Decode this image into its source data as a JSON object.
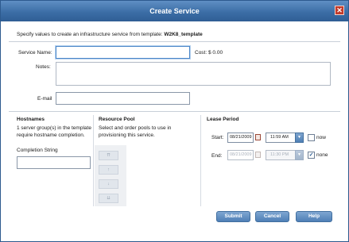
{
  "dialog": {
    "title": "Create Service",
    "close_glyph": "✕"
  },
  "intro": {
    "text": "Specify values to create an infrastructure service from template:",
    "template": "W2K8_template"
  },
  "form": {
    "service_name_label": "Service Name:",
    "service_name_value": "",
    "cost_label": "Cost:",
    "cost_value": "$ 0.00",
    "notes_label": "Notes:",
    "notes_value": "",
    "email_label": "E-mail",
    "email_value": ""
  },
  "hostnames": {
    "title": "Hostnames",
    "description_line1": "1 server group(s) in the template",
    "description_line2": "require hostname completion.",
    "completion_label": "Completion String",
    "completion_value": ""
  },
  "resource_pool": {
    "title": "Resource Pool",
    "description_line1": "Select and order pools to use in",
    "description_line2": "provisioning this service.",
    "buttons": [
      "⇈",
      "↑",
      "↓",
      "⇊"
    ]
  },
  "lease": {
    "title": "Lease Period",
    "start_label": "Start:",
    "start_date": "08/21/2009",
    "start_time": "11:59 AM",
    "now_label": "now",
    "now_checked": false,
    "end_label": "End:",
    "end_date": "08/21/2009",
    "end_time": "11:30 PM",
    "none_label": "none",
    "none_checked": true
  },
  "actions": {
    "submit": "Submit",
    "cancel": "Cancel",
    "help": "Help"
  },
  "colors": {
    "title_bar": "#3c6ea6",
    "button": "#5a8bc1",
    "close": "#c23a2a"
  }
}
